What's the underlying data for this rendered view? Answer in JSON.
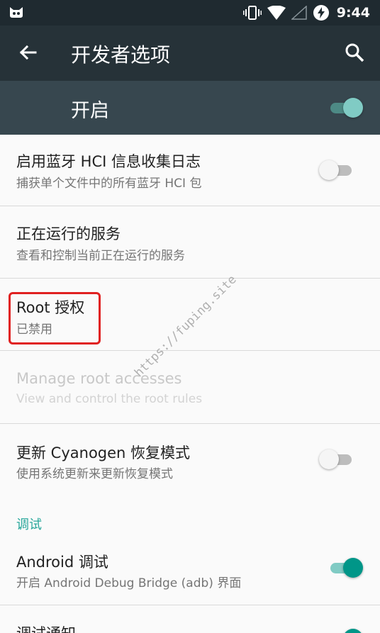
{
  "status_bar": {
    "time": "9:44",
    "icons": [
      "cat-icon",
      "vibrate-icon",
      "wifi-icon",
      "signal-icon",
      "battery-charging-icon"
    ]
  },
  "toolbar": {
    "title": "开发者选项",
    "back_icon": "arrow-back-icon",
    "search_icon": "search-icon"
  },
  "master_switch": {
    "label": "开启",
    "checked": true
  },
  "settings": [
    {
      "title": "启用蓝牙 HCI 信息收集日志",
      "summary": "捕获单个文件中的所有蓝牙 HCI 包",
      "toggle": false
    },
    {
      "title": "正在运行的服务",
      "summary": "查看和控制当前正在运行的服务"
    },
    {
      "title": "Root 授权",
      "summary": "已禁用"
    },
    {
      "title": "Manage root accesses",
      "summary": "View and control the root rules",
      "disabled": true
    },
    {
      "title": "更新 Cyanogen 恢复模式",
      "summary": "使用系统更新来更新恢复模式",
      "toggle": false
    }
  ],
  "debug_section": {
    "header": "调试",
    "items": [
      {
        "title": "Android 调试",
        "summary": "开启 Android Debug Bridge (adb) 界面",
        "toggle": true
      },
      {
        "title": "调试通知",
        "toggle": true
      }
    ]
  },
  "watermark": "https://fuping.site",
  "colors": {
    "status_bar": "#1f2a30",
    "toolbar": "#263238",
    "master_row": "#37474f",
    "accent": "#009688",
    "accent_light": "#80cbc4",
    "highlight": "#e02020"
  }
}
